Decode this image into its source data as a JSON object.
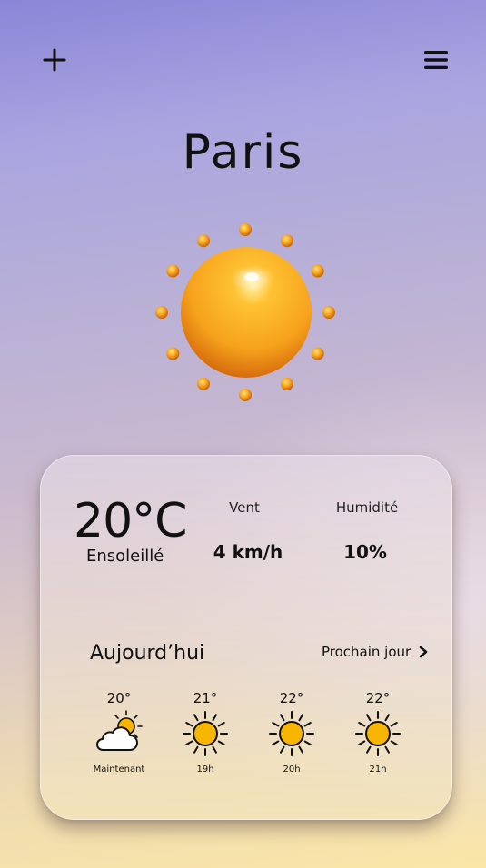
{
  "header": {
    "city": "Paris"
  },
  "current": {
    "temperature": "20°C",
    "condition": "Ensoleillé",
    "icon": "sun-icon"
  },
  "stats": {
    "wind": {
      "label": "Vent",
      "value": "4 km/h"
    },
    "humidity": {
      "label": "Humidité",
      "value": "10%"
    }
  },
  "forecast": {
    "title": "Aujourd’hui",
    "next_label": "Prochain jour",
    "hours": [
      {
        "temp": "20°",
        "label": "Maintenant",
        "icon": "partly-cloudy-icon"
      },
      {
        "temp": "21°",
        "label": "19h",
        "icon": "sun-icon"
      },
      {
        "temp": "22°",
        "label": "20h",
        "icon": "sun-icon"
      },
      {
        "temp": "22°",
        "label": "21h",
        "icon": "sun-icon"
      }
    ]
  },
  "colors": {
    "sun": "#f7b500",
    "sun_3d_core": "#f5a21a",
    "text": "#111111"
  }
}
